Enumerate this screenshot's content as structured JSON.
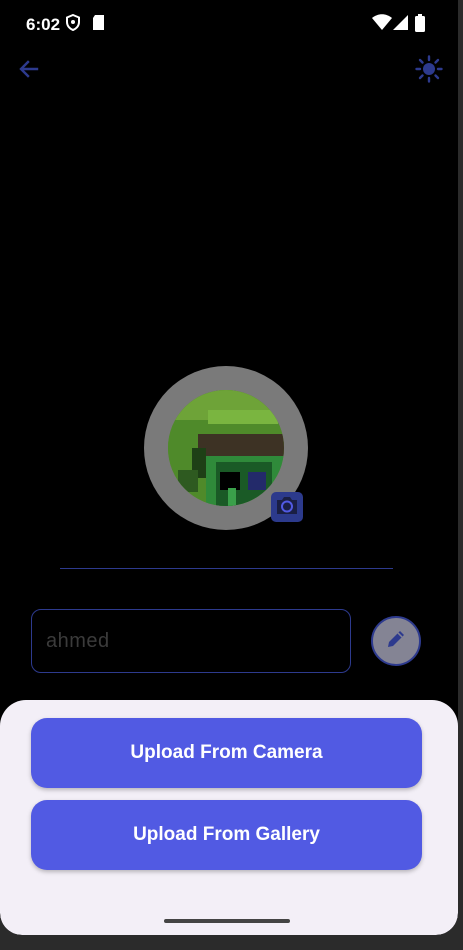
{
  "status_bar": {
    "time": "6:02",
    "left_icons": [
      "shield-icon",
      "sd-card-icon"
    ],
    "right_icons": [
      "wifi-icon",
      "signal-icon",
      "battery-icon"
    ]
  },
  "app_bar": {
    "back_icon": "arrow-back-icon",
    "theme_icon": "sun-icon"
  },
  "profile": {
    "avatar_icon": "pixel-avatar",
    "camera_icon": "camera-icon"
  },
  "name_field": {
    "value": "ahmed"
  },
  "edit_icon": "pencil-icon",
  "bottom_sheet": {
    "camera_button": "Upload From Camera",
    "gallery_button": "Upload From Gallery"
  },
  "colors": {
    "accent": "#515ae3",
    "dark_accent": "#2d3a8e",
    "sheet_bg": "#f3eff7"
  }
}
